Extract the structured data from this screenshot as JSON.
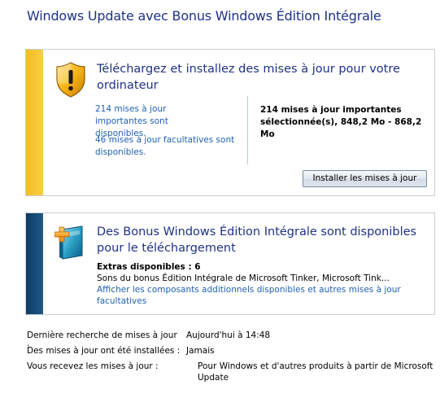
{
  "window": {
    "title": "Windows Update avec Bonus Windows Édition Intégrale"
  },
  "update_panel": {
    "heading": "Téléchargez et installez des mises à jour pour votre ordinateur",
    "important_link": "214 mises à jour importantes sont disponibles.",
    "optional_link": "46 mises à jour facultatives sont disponibles.",
    "selected_summary": "214 mises à jour importantes sélectionnée(s), 848,2 Mo - 868,2 Mo",
    "install_button": "Installer les mises à jour",
    "icon": "shield-warning-icon",
    "accent_color": "#f3bb24"
  },
  "bonus_panel": {
    "heading": "Des Bonus Windows Édition Intégrale sont disponibles pour le téléchargement",
    "extras_label": "Extras disponibles : 6",
    "description": "Sons du bonus Édition Intégrale de Microsoft Tinker, Microsoft Tink...",
    "components_link": "Afficher les composants additionnels disponibles et autres mises à jour facultatives",
    "icon": "bonus-package-icon",
    "accent_color": "#0f3a63"
  },
  "status": {
    "last_check_label": "Dernière recherche de mises à jour :",
    "last_check_value": "Aujourd'hui à 14:48",
    "installed_label": "Des mises à jour ont été installées :",
    "installed_value": "Jamais",
    "source_label": "Vous recevez les mises à jour :",
    "source_value": "Pour Windows et d'autres produits à partir de Microsoft Update"
  }
}
